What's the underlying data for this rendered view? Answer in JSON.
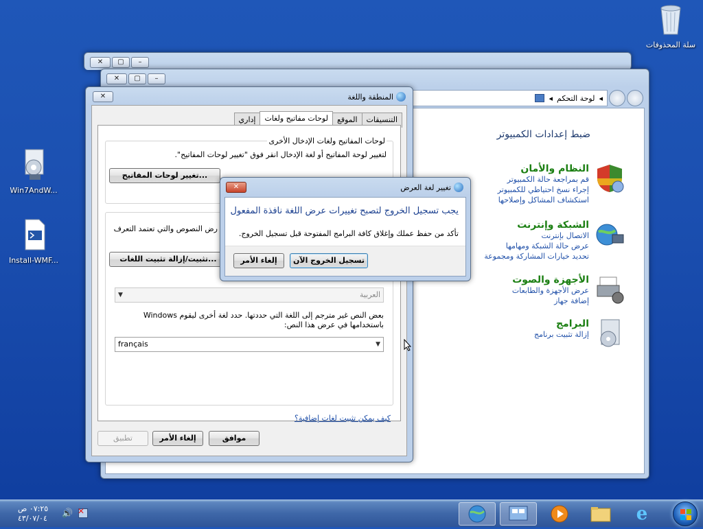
{
  "desktop": {
    "icons": [
      {
        "label": "سلة المحذوفات"
      },
      {
        "label": "Win7AndW..."
      },
      {
        "label": "Install-WMF..."
      }
    ]
  },
  "control_panel": {
    "breadcrumb": "لوحة التحكم",
    "heading": "ضبط إعدادات الكمبيوتر",
    "categories": [
      {
        "title": "النظام والأمان",
        "links": [
          "قم بمراجعة حالة الكمبيوتر",
          "إجراء نسخ احتياطي للكمبيوتر",
          "استكشاف المشاكل وإصلاحها"
        ]
      },
      {
        "title": "الشبكة وإنترنت",
        "links": [
          "الاتصال بإنترنت",
          "عرض حالة الشبكة ومهامها",
          "تحديد خيارات المشاركة ومجموعة"
        ]
      },
      {
        "title": "الأجهزة والصوت",
        "links": [
          "عرض الأجهزة والطابعات",
          "إضافة جهاز"
        ]
      },
      {
        "title": "البرامج",
        "links": [
          "إزالة تثبيت برنامج"
        ]
      }
    ]
  },
  "region_dialog": {
    "title": "المنطقة واللغة",
    "tabs": [
      "التنسيقات",
      "الموقع",
      "لوحات مفاتيح ولغات",
      "إداري"
    ],
    "active_tab": "لوحات مفاتيح ولغات",
    "keyboards_group_title": "لوحات المفاتيح ولغات الإدخال الأخرى",
    "keyboards_desc": "لتغيير لوحة المفاتيح أو لغة الإدخال انقر فوق \"تغيير لوحات المفاتيح\".",
    "change_keyboards_button": "تغيير لوحات المفاتيح...",
    "help_link_partial": "؟",
    "display_lang_desc": "رض النصوص والتي تعتمد التعرف",
    "install_langs_button": "تثبيت/إزالة تثبيت اللغات...",
    "display_lang_combo": "العربية",
    "note_text": "بعض النص غير مترجم إلى اللغة التي حددتها. حدد لغة أخرى ليقوم Windows باستخدامها في عرض هذا النص:",
    "fallback_lang_combo": "français",
    "install_more_link": "كيف يمكن تثبيت لغات إضافية؟",
    "ok_button": "موافق",
    "cancel_button": "إلغاء الأمر",
    "apply_button": "تطبيق"
  },
  "message_box": {
    "title": "تغيير لغة العرض",
    "main_instruction": "يجب تسجيل الخروج لتصبح تغييرات عرض اللغة نافذة المفعول",
    "content": "تأكد من حفظ عملك وإغلاق كافة البرامج المفتوحة قبل تسجيل الخروج.",
    "logoff_button": "تسجيل الخروج الآن",
    "cancel_button": "إلغاء الأمر"
  },
  "taskbar": {
    "clock_time": "٠٧:٢٥ ص",
    "clock_date": "٤٣/٠٧/٠٤"
  },
  "colors": {
    "desktop": "#1b4fb0",
    "category_title": "#1b7f12",
    "link": "#1f4fa8"
  }
}
